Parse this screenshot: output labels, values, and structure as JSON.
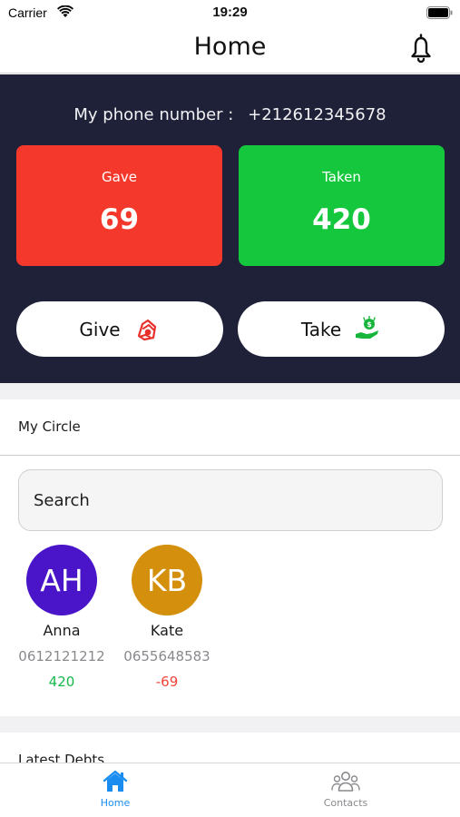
{
  "status_bar": {
    "carrier": "Carrier",
    "time": "19:29"
  },
  "nav": {
    "title": "Home"
  },
  "hero": {
    "phone_label": "My phone number :",
    "phone_number": "+212612345678",
    "gave": {
      "label": "Gave",
      "value": "69",
      "color": "#f4392c"
    },
    "taken": {
      "label": "Taken",
      "value": "420",
      "color": "#14c73c"
    },
    "give_button": "Give",
    "take_button": "Take"
  },
  "circle": {
    "title": "My Circle",
    "search_placeholder": "Search",
    "contacts": [
      {
        "initials": "AH",
        "name": "Anna",
        "phone": "0612121212",
        "balance": "420",
        "avatar_color": "#4a14c9",
        "balance_color": "#14b84a"
      },
      {
        "initials": "KB",
        "name": "Kate",
        "phone": "0655648583",
        "balance": "-69",
        "avatar_color": "#d4900c",
        "balance_color": "#f04438"
      }
    ]
  },
  "latest": {
    "title": "Latest Debts"
  },
  "tabs": [
    {
      "label": "Home",
      "icon": "home-icon",
      "active": true,
      "color": "#1a8cf0"
    },
    {
      "label": "Contacts",
      "icon": "contacts-icon",
      "active": false,
      "color": "#8a8a8e"
    }
  ]
}
